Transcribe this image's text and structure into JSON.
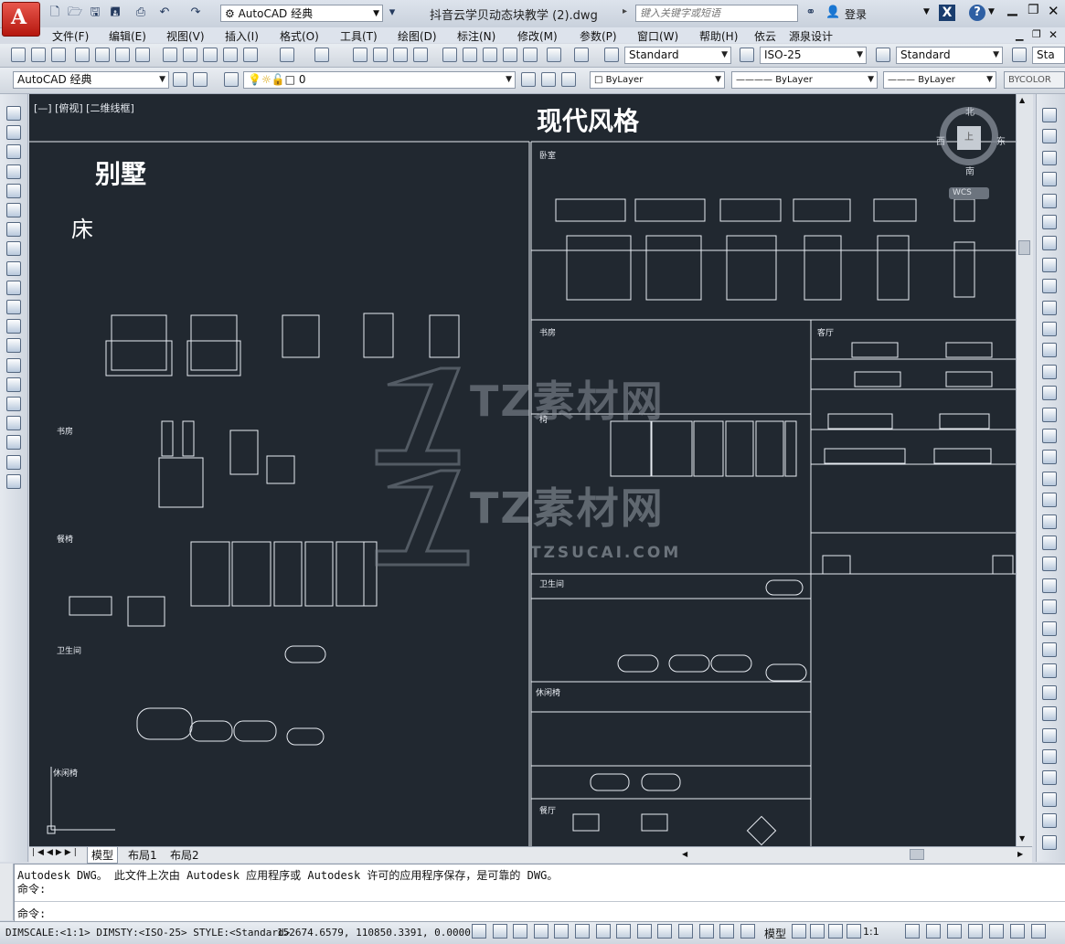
{
  "title_bar": {
    "workspace": "AutoCAD 经典",
    "document_title": "抖音云学贝动态块教学 (2).dwg",
    "search_placeholder": "键入关键字或短语",
    "login": "登录",
    "help": "?"
  },
  "menu": [
    "文件(F)",
    "编辑(E)",
    "视图(V)",
    "插入(I)",
    "格式(O)",
    "工具(T)",
    "绘图(D)",
    "标注(N)",
    "修改(M)",
    "参数(P)",
    "窗口(W)",
    "帮助(H)",
    "依云",
    "源泉设计"
  ],
  "toolbar1": {
    "text_style": "Standard",
    "dim_style": "ISO-25",
    "table_style": "Standard",
    "multileader_style": "Sta"
  },
  "toolbar2": {
    "workspace": "AutoCAD 经典",
    "layer": "0",
    "color": "ByLayer",
    "linetype": "ByLayer",
    "lineweight": "ByLayer",
    "plot_style": "BYCOLOR"
  },
  "viewport": {
    "label": "[—] [俯视] [二维线框]",
    "viewcube_north": "北",
    "viewcube_south": "南",
    "viewcube_west": "西",
    "viewcube_east": "东",
    "viewcube_top": "上",
    "wcs": "WCS"
  },
  "drawing": {
    "heading_modern": "现代风格",
    "heading_villa": "别墅",
    "heading_bed": "床",
    "watermark_brand": "TZ素材网",
    "watermark_url": "TZSUCAI.COM",
    "small_labels": {
      "bedroom": "卧室",
      "study": "书房",
      "bathroom": "卫生间",
      "bathroom_right": "卫生间",
      "leisure": "休闲椅",
      "leisure_left": "休闲椅",
      "dining": "餐厅",
      "living": "客厅",
      "dining_left": "餐椅",
      "study_right": "书房",
      "chair_left": "椅"
    }
  },
  "layout_tabs": [
    "模型",
    "布局1",
    "布局2"
  ],
  "command": {
    "history_line": "Autodesk DWG。  此文件上次由 Autodesk 应用程序或 Autodesk 许可的应用程序保存，是可靠的 DWG。",
    "prompt1": "命令:",
    "prompt2": "命令:"
  },
  "status": {
    "dim_info": "DIMSCALE:<1:1> DIMSTY:<ISO-25> STYLE:<Standard>",
    "coordinates": "152674.6579, 110850.3391, 0.0000",
    "model_label": "模型",
    "scale": "1:1"
  },
  "colors": {
    "canvas_bg": "#212830",
    "drawing_lines": "#e8ecf2",
    "chrome": "#d6dbe4"
  }
}
